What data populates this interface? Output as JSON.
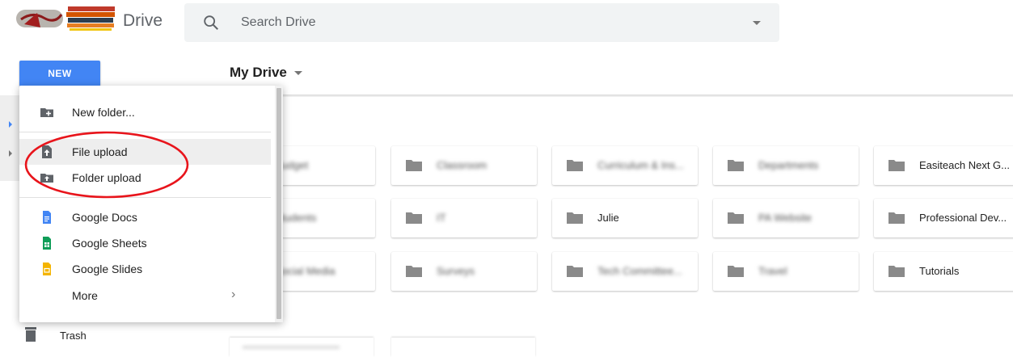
{
  "header": {
    "app_title": "Drive",
    "search_placeholder": "Search Drive"
  },
  "new_button_label": "NEW",
  "content": {
    "title": "My Drive"
  },
  "new_menu": {
    "items": [
      {
        "label": "New folder...",
        "icon": "new-folder-icon"
      },
      {
        "label": "File upload",
        "icon": "file-upload-icon"
      },
      {
        "label": "Folder upload",
        "icon": "folder-upload-icon"
      },
      {
        "label": "Google Docs",
        "icon": "google-docs-icon",
        "color": "#4285f4"
      },
      {
        "label": "Google Sheets",
        "icon": "google-sheets-icon",
        "color": "#0f9d58"
      },
      {
        "label": "Google Slides",
        "icon": "google-slides-icon",
        "color": "#f4b400"
      },
      {
        "label": "More",
        "icon": "chevron-right-icon"
      }
    ],
    "more_chevron": "›"
  },
  "folders": [
    {
      "name": "Budget"
    },
    {
      "name": "Classroom"
    },
    {
      "name": "Curriculum & Ins..."
    },
    {
      "name": "Departments"
    },
    {
      "name": "Easiteach Next G..."
    },
    {
      "name": "Students"
    },
    {
      "name": "IT"
    },
    {
      "name": "Julie"
    },
    {
      "name": "PA Website"
    },
    {
      "name": "Professional Dev..."
    },
    {
      "name": "Social Media"
    },
    {
      "name": "Surveys"
    },
    {
      "name": "Tech Committee..."
    },
    {
      "name": "Travel"
    },
    {
      "name": "Tutorials"
    }
  ],
  "sidebar": {
    "trash_label": "Trash"
  },
  "colors": {
    "new_button": "#4285f4",
    "annotation": "#e8141b",
    "folder_icon": "#8a8a8a"
  }
}
